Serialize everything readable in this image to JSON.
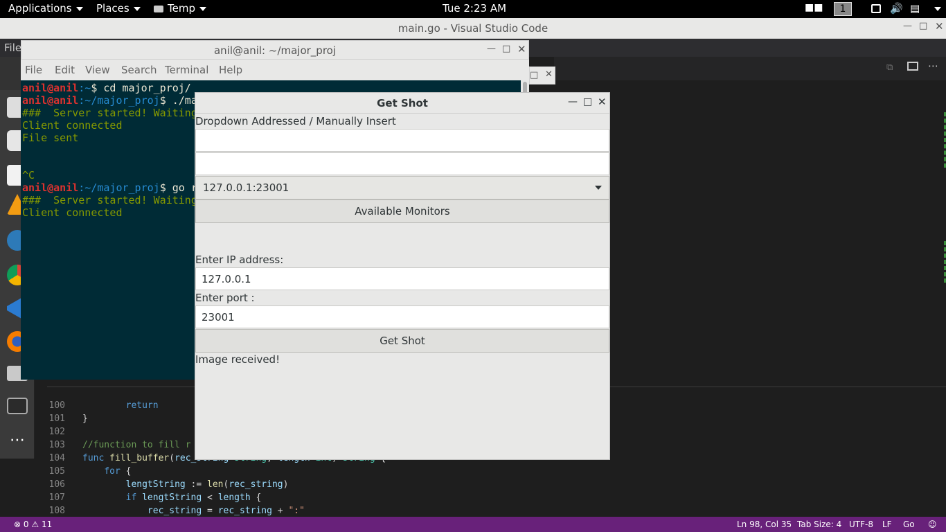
{
  "topbar": {
    "applications": "Applications",
    "places": "Places",
    "temp": "Temp",
    "clock": "Tue  2:23 AM",
    "workspace": "1"
  },
  "vscode": {
    "title": "main.go - Visual Studio Code",
    "menu_file": "File",
    "statusbar": {
      "errors": "0",
      "warnings": "11",
      "position": "Ln 98, Col 35",
      "tab_size": "Tab Size: 4",
      "encoding": "UTF-8",
      "eol": "LF",
      "language": "Go"
    },
    "code_lines": [
      {
        "num": "100",
        "text": "        return"
      },
      {
        "num": "101",
        "text": "}"
      },
      {
        "num": "102",
        "text": ""
      },
      {
        "num": "103",
        "text": "//function to fill r"
      },
      {
        "num": "104",
        "text": "func fill_buffer(rec_string string, length int) string {"
      },
      {
        "num": "105",
        "text": "    for {"
      },
      {
        "num": "106",
        "text": "        lengtString := len(rec_string)"
      },
      {
        "num": "107",
        "text": "        if lengtString < length {"
      },
      {
        "num": "108",
        "text": "            rec_string = rec_string + \":\""
      }
    ]
  },
  "terminal": {
    "title": "anil@anil: ~/major_proj",
    "menu": [
      "File",
      "Edit",
      "View",
      "Search",
      "Terminal",
      "Help"
    ],
    "lines": {
      "l1_user": "anil@anil",
      "l1_path": ":~",
      "l1_cmd": "$ cd major_proj/",
      "l2_user": "anil@anil",
      "l2_path": ":~/major_proj",
      "l2_cmd": "$ ./ma",
      "l3": "###  Server started! Waiting",
      "l4": "Client connected",
      "l5": "File sent",
      "l6": "^C",
      "l7_user": "anil@anil",
      "l7_path": ":~/major_proj",
      "l7_cmd": "$ go r",
      "l8": "###  Server started! Waiting",
      "l9": "Client connected"
    }
  },
  "dialog": {
    "title": "Get Shot",
    "dropdown_label": "Dropdown Addressed / Manually Insert",
    "entry1_value": "",
    "entry2_value": "",
    "combo_value": "127.0.0.1:23001",
    "monitors_button": "Available Monitors",
    "ip_label": "Enter IP address:",
    "ip_value": "127.0.0.1",
    "port_label": "Enter port :",
    "port_value": "23001",
    "getshot_button": "Get Shot",
    "status": "Image received!"
  },
  "icons": {
    "close": "close-icon",
    "minimize": "minimize-icon",
    "maximize": "maximize-icon"
  }
}
